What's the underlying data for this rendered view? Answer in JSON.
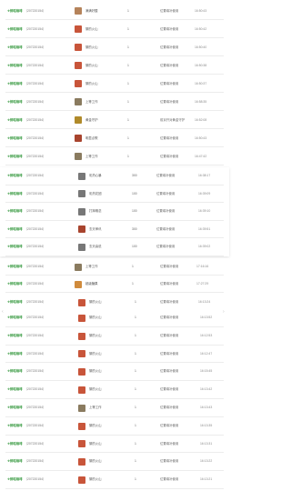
{
  "brand": "❖鲜呱咖啡",
  "icon_colors": {
    "volcano": "#c8553a",
    "farm": "#b5835a",
    "chef": "#8a7b5f",
    "guard": "#b08a2a",
    "chest": "#a8442e",
    "cat": "#777777",
    "box": "#d08b3c"
  },
  "section1": [
    {
      "code": "（207220154）",
      "icon": "farm",
      "name": "满满好酸",
      "count": "1",
      "status": "位置填补使用",
      "time": "16:50:43"
    },
    {
      "code": "（207220154）",
      "icon": "volcano",
      "name": "黎的火山",
      "count": "1",
      "status": "位置填补使用",
      "time": "16:50:42"
    },
    {
      "code": "（207220154）",
      "icon": "volcano",
      "name": "黎的火山",
      "count": "1",
      "status": "位置填补使用",
      "time": "16:50:40"
    },
    {
      "code": "（207220154）",
      "icon": "volcano",
      "name": "黎的火山",
      "count": "1",
      "status": "位置填补使用",
      "time": "16:50:38"
    },
    {
      "code": "（207220154）",
      "icon": "volcano",
      "name": "黎的火山",
      "count": "1",
      "status": "位置填补使用",
      "time": "16:50:37"
    },
    {
      "code": "（207220154）",
      "icon": "chef",
      "name": "上等工作",
      "count": "1",
      "status": "位置填补使用",
      "time": "16:58:35"
    },
    {
      "code": "（207220154）",
      "icon": "guard",
      "name": "黄金守护",
      "count": "1",
      "status": "前京开对黄金守护",
      "time": "16:52:08"
    },
    {
      "code": "（207220154）",
      "icon": "chest",
      "name": "明显点歌",
      "count": "1",
      "status": "位置填补使用",
      "time": "16:50:43"
    },
    {
      "code": "（207220154）",
      "icon": "chef",
      "name": "上等工作",
      "count": "1",
      "status": "位置填补使用",
      "time": "16:47:42"
    }
  ],
  "section2": [
    {
      "code": "（207220154）",
      "icon": "cat",
      "name": "彩热心暴",
      "count": "300",
      "status": "位置填补使用",
      "time": "16:38:17"
    },
    {
      "code": "（207220154）",
      "icon": "cat",
      "name": "彩热花团",
      "count": "100",
      "status": "位置填补使用",
      "time": "16:39:09"
    },
    {
      "code": "（207220154）",
      "icon": "cat",
      "name": "打摔概念",
      "count": "100",
      "status": "位置填补使用",
      "time": "16:39:10"
    },
    {
      "code": "（207220154）",
      "icon": "chest",
      "name": "玄天审讯",
      "count": "300",
      "status": "位置填补使用",
      "time": "16:39:51"
    },
    {
      "code": "（207220154）",
      "icon": "cat",
      "name": "玄天喜说",
      "count": "100",
      "status": "位置填补使用",
      "time": "16:39:02"
    }
  ],
  "section3": [
    {
      "code": "（207220154）",
      "icon": "chef",
      "name": "上等工作",
      "count": "1",
      "status": "位置填补使用",
      "time": "17:16:16"
    },
    {
      "code": "（207220154）",
      "icon": "box",
      "name": "超级糖果",
      "count": "1",
      "status": "位置填补使用",
      "time": "17:27:29"
    }
  ],
  "section4": [
    {
      "code": "（207220154）",
      "icon": "volcano",
      "name": "黎的火山",
      "count": "1",
      "status": "位置填补使用",
      "time": "16:13:24"
    }
  ],
  "section5": [
    {
      "code": "（207220154）",
      "icon": "volcano",
      "name": "黎的火山",
      "count": "1",
      "status": "位置填补使用",
      "time": "16:13:52"
    },
    {
      "code": "（207220154）",
      "icon": "volcano",
      "name": "黎的火山",
      "count": "1",
      "status": "位置填补使用",
      "time": "16:12:53"
    },
    {
      "code": "（207220154）",
      "icon": "volcano",
      "name": "黎的火山",
      "count": "1",
      "status": "位置填补使用",
      "time": "16:12:47"
    },
    {
      "code": "（207220154）",
      "icon": "volcano",
      "name": "黎的火山",
      "count": "1",
      "status": "位置填补使用",
      "time": "16:15:45"
    },
    {
      "code": "（207220154）",
      "icon": "volcano",
      "name": "黎的火山",
      "count": "1",
      "status": "位置填补使用",
      "time": "16:13:42"
    },
    {
      "code": "（207220154）",
      "icon": "chef",
      "name": "上等工作",
      "count": "1",
      "status": "位置填补使用",
      "time": "16:13:43"
    },
    {
      "code": "（207220154）",
      "icon": "volcano",
      "name": "黎的火山",
      "count": "1",
      "status": "位置填补使用",
      "time": "16:13:35"
    },
    {
      "code": "（207220154）",
      "icon": "volcano",
      "name": "黎的火山",
      "count": "1",
      "status": "位置填补使用",
      "time": "16:13:31"
    },
    {
      "code": "（207220154）",
      "icon": "volcano",
      "name": "黎的火山",
      "count": "1",
      "status": "位置填补使用",
      "time": "16:13:22"
    },
    {
      "code": "（207220154）",
      "icon": "volcano",
      "name": "黎的火山",
      "count": "1",
      "status": "位置填补使用",
      "time": "16:13:21"
    }
  ]
}
